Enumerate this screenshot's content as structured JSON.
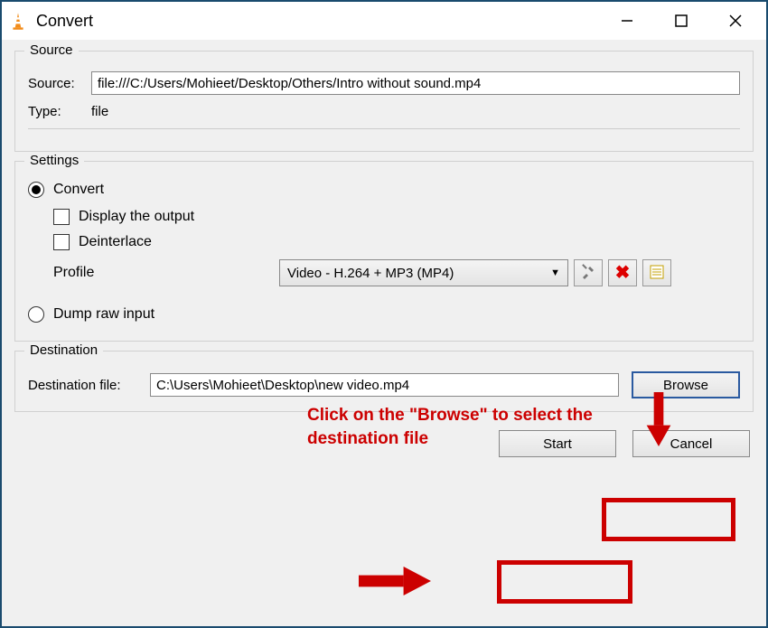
{
  "window": {
    "title": "Convert"
  },
  "source_group": {
    "legend": "Source",
    "source_label": "Source:",
    "source_value": "file:///C:/Users/Mohieet/Desktop/Others/Intro without sound.mp4",
    "type_label": "Type:",
    "type_value": "file"
  },
  "settings_group": {
    "legend": "Settings",
    "convert_label": "Convert",
    "display_output_label": "Display the output",
    "deinterlace_label": "Deinterlace",
    "profile_label": "Profile",
    "profile_value": "Video - H.264 + MP3 (MP4)",
    "dump_raw_label": "Dump raw input"
  },
  "destination_group": {
    "legend": "Destination",
    "dest_label": "Destination file:",
    "dest_value": "C:\\Users\\Mohieet\\Desktop\\new video.mp4",
    "browse_label": "Browse"
  },
  "footer": {
    "start_label": "Start",
    "cancel_label": "Cancel"
  },
  "annotation": {
    "helper_text": "Click on the \"Browse\" to select the destination file"
  },
  "icons": {
    "tools": "tools-icon",
    "delete": "delete-icon",
    "new_profile": "new-profile-icon"
  }
}
